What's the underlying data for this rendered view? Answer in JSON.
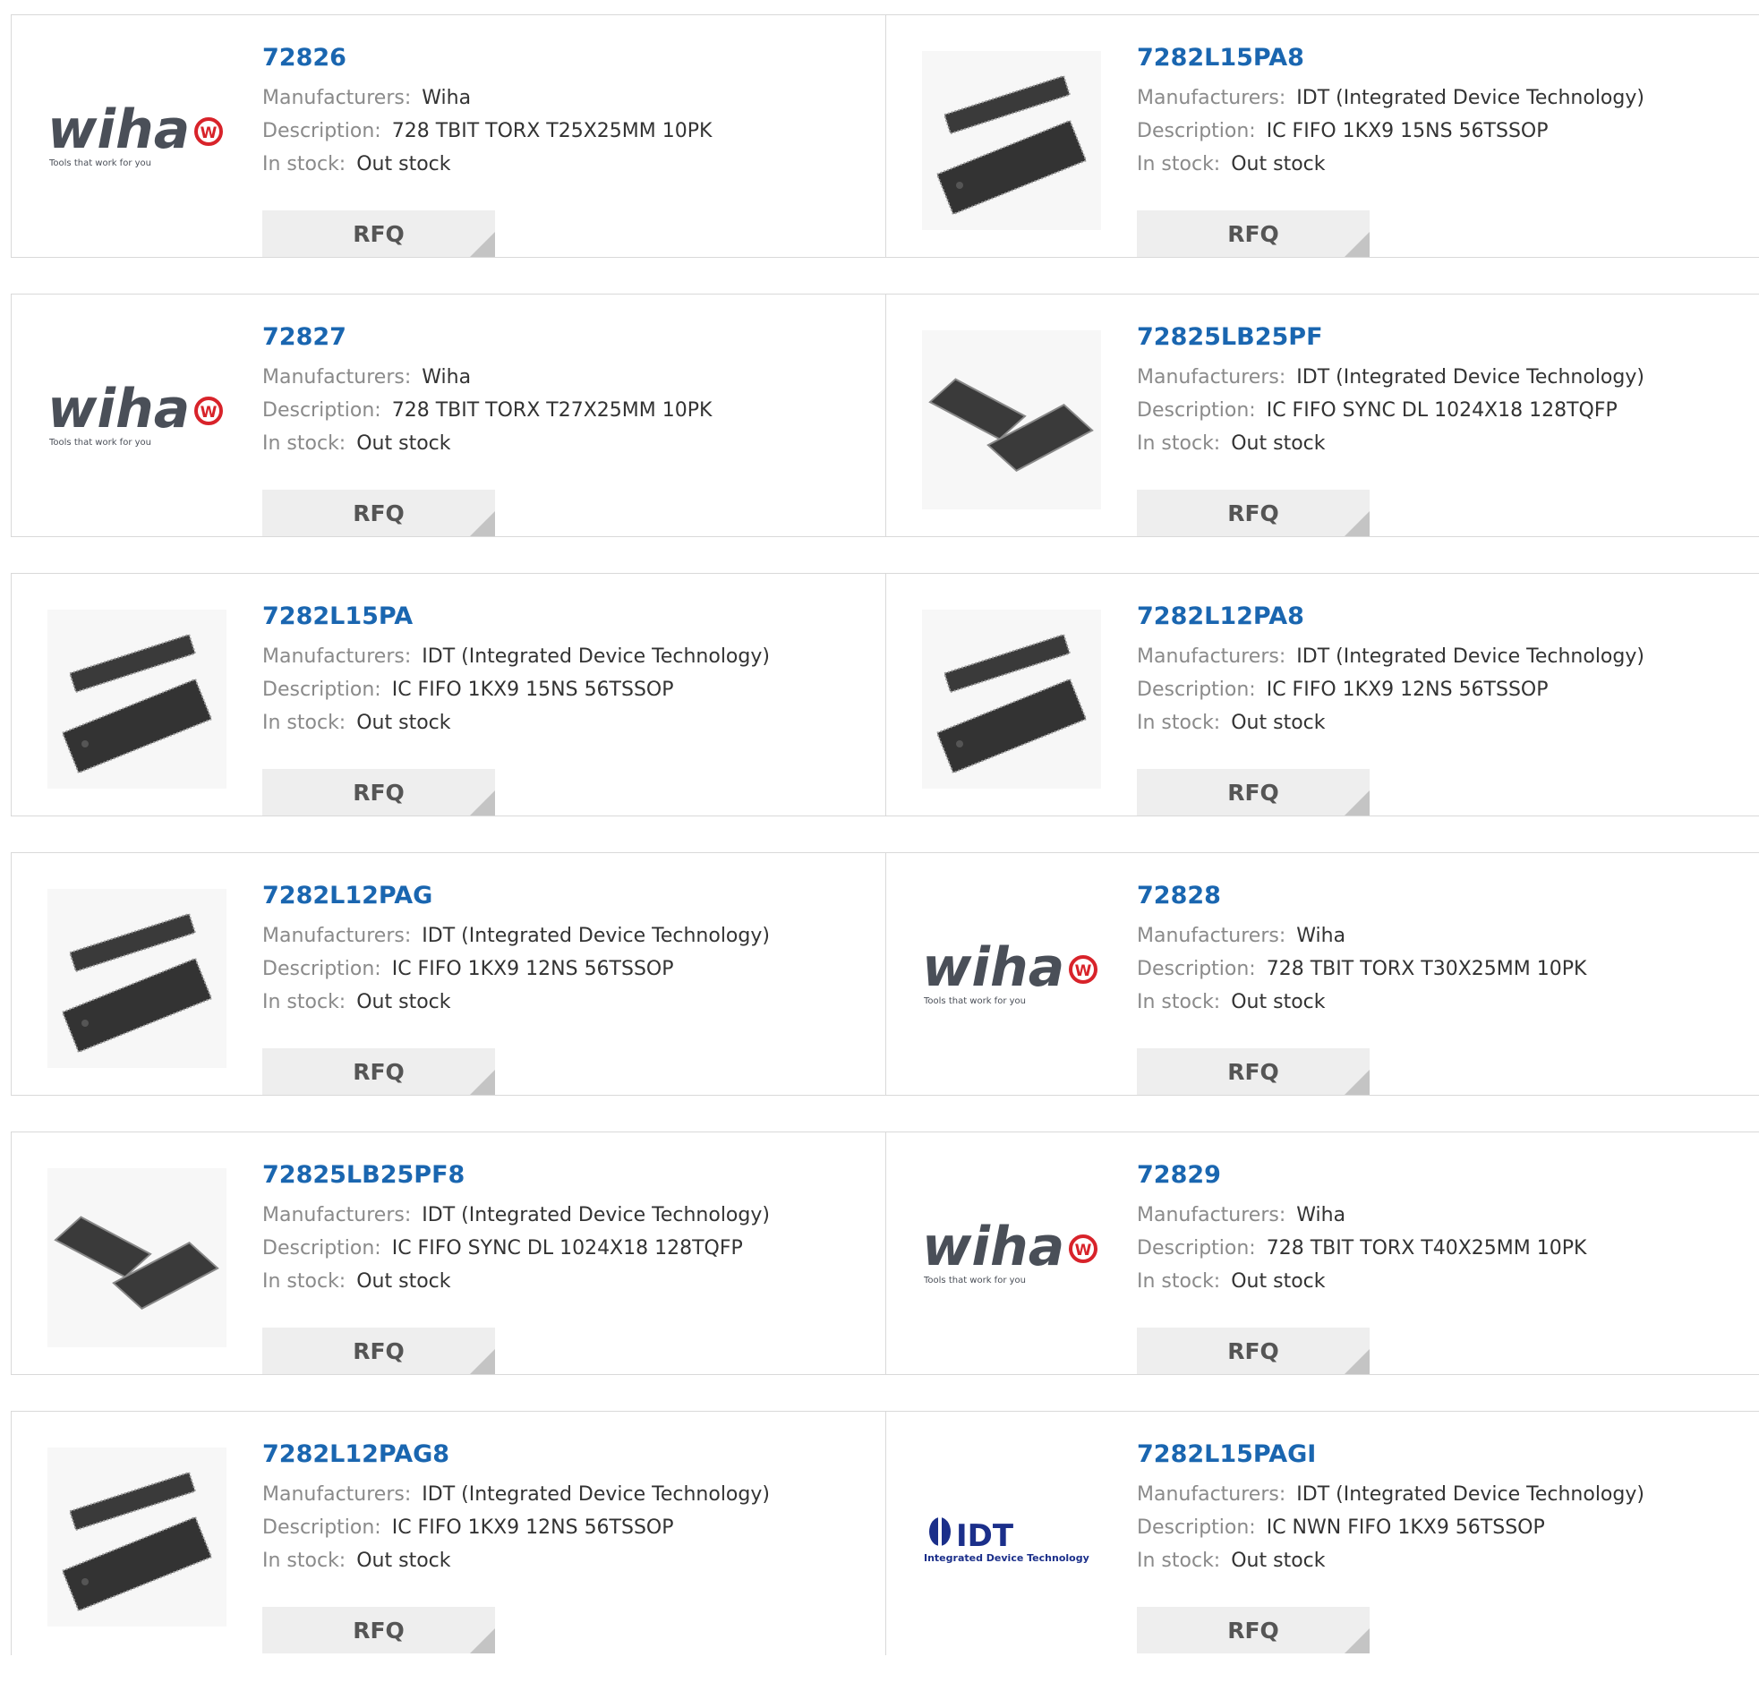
{
  "labels": {
    "manufacturers": "Manufacturers:",
    "description": "Description:",
    "stock": "In stock:",
    "rfq": "RFQ"
  },
  "logos": {
    "wiha_text": "wiha",
    "wiha_tagline": "Tools that work for you",
    "wiha_badge": "W",
    "idt_text": "IDT",
    "idt_tagline": "Integrated Device Technology"
  },
  "colors": {
    "part_link": "#1a66b0",
    "wiha_red": "#d8232a",
    "wiha_grey": "#4a4f58",
    "idt_blue": "#1b2f8a",
    "rfq_bg": "#eeeeee"
  },
  "products": [
    {
      "part": "72826",
      "manufacturer": "Wiha",
      "description": "728 TBIT TORX T25X25MM 10PK",
      "stock": "Out stock",
      "image": "wiha-logo"
    },
    {
      "part": "7282L15PA8",
      "manufacturer": "IDT (Integrated Device Technology)",
      "description": "IC FIFO 1KX9 15NS 56TSSOP",
      "stock": "Out stock",
      "image": "tssop-chip"
    },
    {
      "part": "72827",
      "manufacturer": "Wiha",
      "description": "728 TBIT TORX T27X25MM 10PK",
      "stock": "Out stock",
      "image": "wiha-logo"
    },
    {
      "part": "72825LB25PF",
      "manufacturer": "IDT (Integrated Device Technology)",
      "description": "IC FIFO SYNC DL 1024X18 128TQFP",
      "stock": "Out stock",
      "image": "tqfp-chip"
    },
    {
      "part": "7282L15PA",
      "manufacturer": "IDT (Integrated Device Technology)",
      "description": "IC FIFO 1KX9 15NS 56TSSOP",
      "stock": "Out stock",
      "image": "tssop-chip"
    },
    {
      "part": "7282L12PA8",
      "manufacturer": "IDT (Integrated Device Technology)",
      "description": "IC FIFO 1KX9 12NS 56TSSOP",
      "stock": "Out stock",
      "image": "tssop-chip"
    },
    {
      "part": "7282L12PAG",
      "manufacturer": "IDT (Integrated Device Technology)",
      "description": "IC FIFO 1KX9 12NS 56TSSOP",
      "stock": "Out stock",
      "image": "tssop-chip"
    },
    {
      "part": "72828",
      "manufacturer": "Wiha",
      "description": "728 TBIT TORX T30X25MM 10PK",
      "stock": "Out stock",
      "image": "wiha-logo"
    },
    {
      "part": "72825LB25PF8",
      "manufacturer": "IDT (Integrated Device Technology)",
      "description": "IC FIFO SYNC DL 1024X18 128TQFP",
      "stock": "Out stock",
      "image": "tqfp-chip"
    },
    {
      "part": "72829",
      "manufacturer": "Wiha",
      "description": "728 TBIT TORX T40X25MM 10PK",
      "stock": "Out stock",
      "image": "wiha-logo"
    },
    {
      "part": "7282L12PAG8",
      "manufacturer": "IDT (Integrated Device Technology)",
      "description": "IC FIFO 1KX9 12NS 56TSSOP",
      "stock": "Out stock",
      "image": "tssop-chip"
    },
    {
      "part": "7282L15PAGI",
      "manufacturer": "IDT (Integrated Device Technology)",
      "description": "IC NWN FIFO 1KX9 56TSSOP",
      "stock": "Out stock",
      "image": "idt-logo"
    }
  ]
}
